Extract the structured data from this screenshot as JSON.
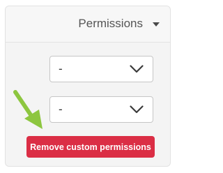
{
  "header": {
    "label": "Permissions",
    "icon": "caret-down-icon"
  },
  "selects": [
    {
      "value": "-",
      "icon": "chevron-down-icon"
    },
    {
      "value": "-",
      "icon": "chevron-down-icon"
    }
  ],
  "actions": {
    "remove_label": "Remove custom permissions"
  },
  "colors": {
    "danger": "#db2e45",
    "pointer_arrow": "#8dc63f"
  }
}
